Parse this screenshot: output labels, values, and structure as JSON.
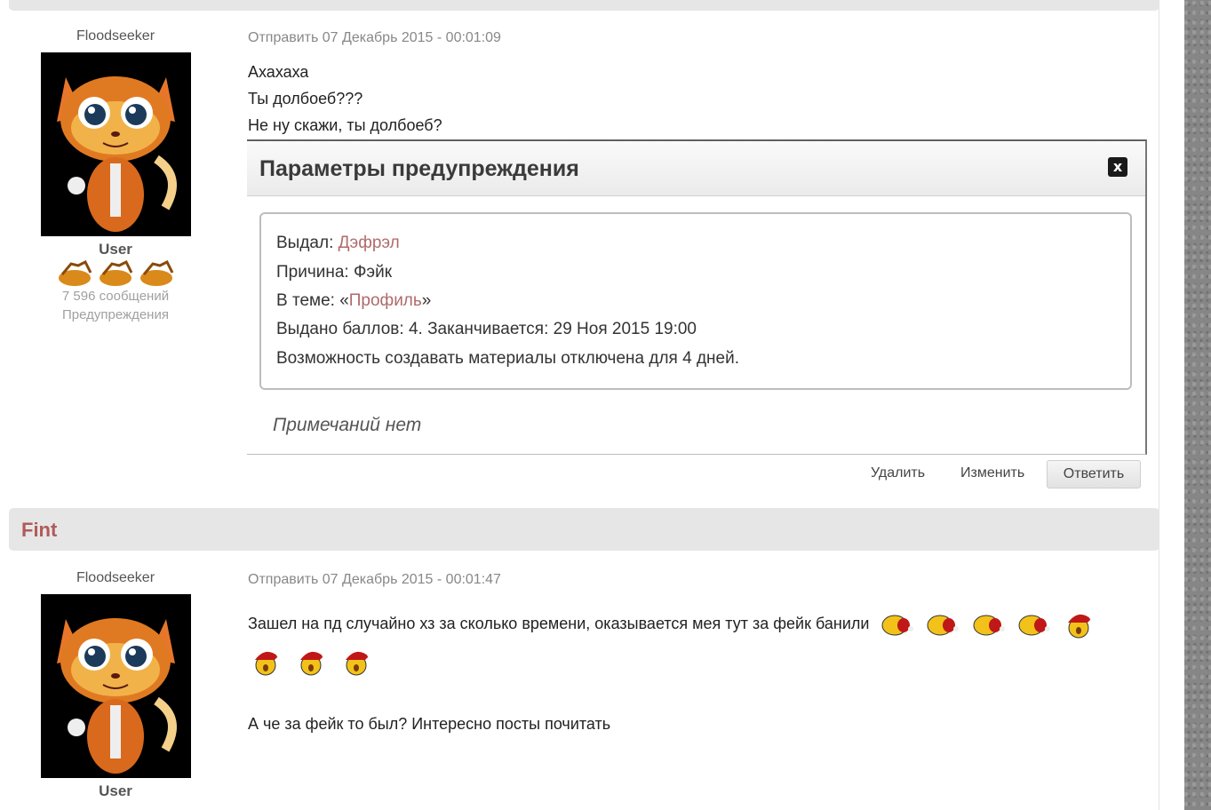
{
  "post1": {
    "author_name": "Floodseeker",
    "group": "User",
    "posts_count": "7 596 сообщений",
    "warnings_link": "Предупреждения",
    "date": "Отправить 07 Декабрь 2015 - 00:01:09",
    "lines": [
      "Ахахаха",
      "Ты долбоеб???",
      "Не ну скажи, ты долбоеб?"
    ],
    "warning": {
      "title": "Параметры предупреждения",
      "close_label": "x",
      "issued_by_label": "Выдал: ",
      "issued_by": "Дэфрэл",
      "reason": "Причина: Фэйк",
      "topic_label": "В теме: «",
      "topic": "Профиль",
      "topic_suffix": "»",
      "points": "Выдано баллов: 4. Заканчивается: 29 Ноя 2015 19:00",
      "restriction": "Возможность создавать материалы отключена для 4 дней.",
      "notes": "Примечаний нет"
    },
    "actions": {
      "delete": "Удалить",
      "edit": "Изменить",
      "reply": "Ответить"
    }
  },
  "post2": {
    "title": "Fint",
    "author_name": "Floodseeker",
    "group": "User",
    "date": "Отправить 07 Декабрь 2015 - 00:01:47",
    "line1": "Зашел на пд случайно хз за сколько времени, оказывается мея тут за фейк банили",
    "line2": "А че за фейк то был? Интересно посты почитать"
  }
}
